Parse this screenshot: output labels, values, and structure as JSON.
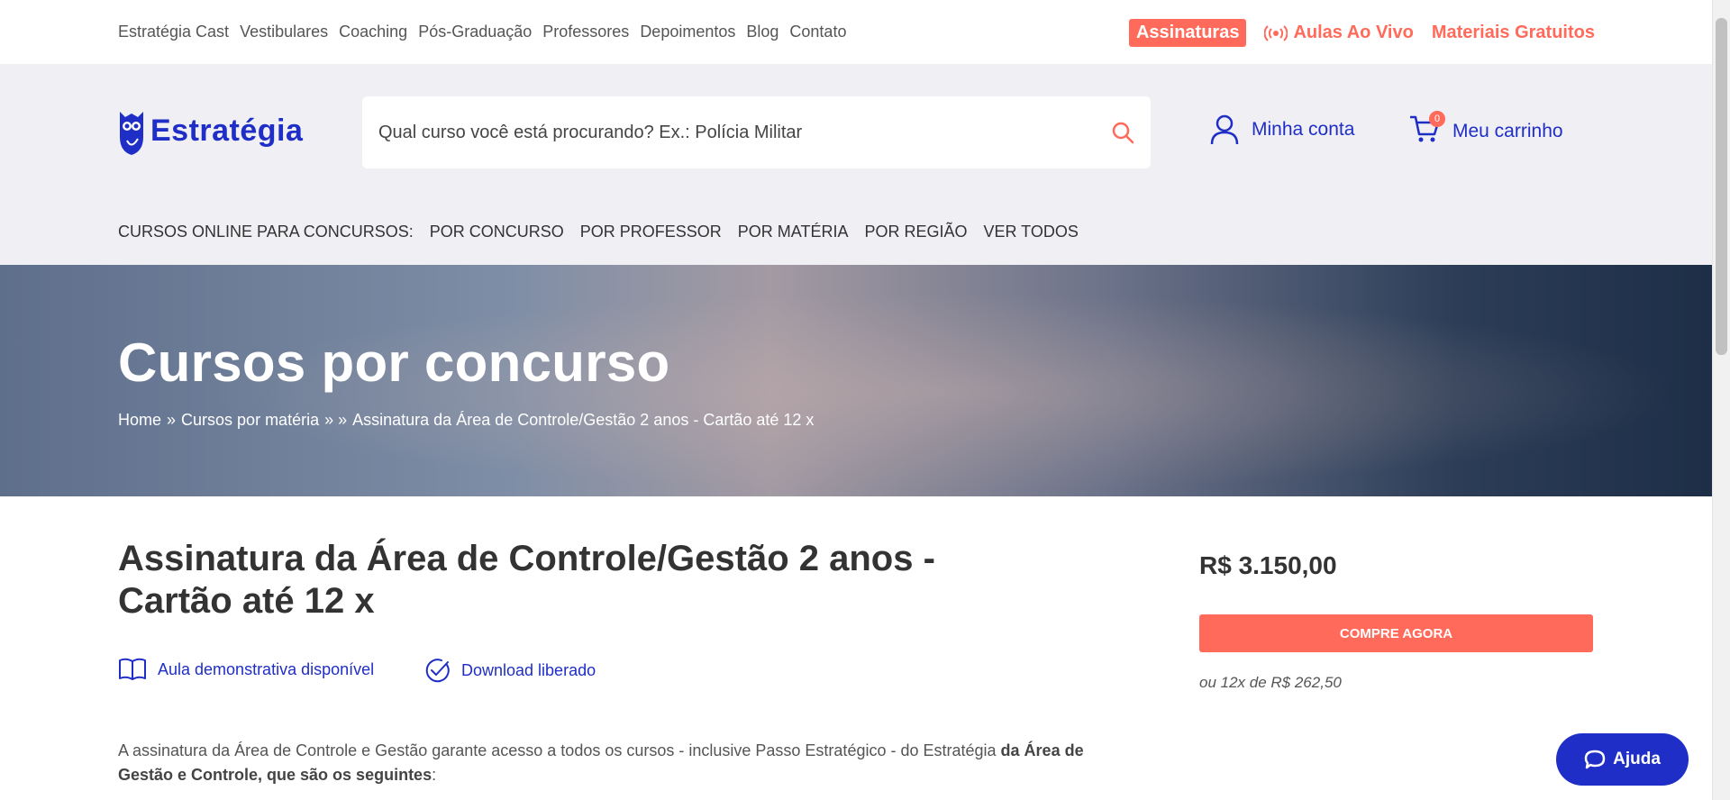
{
  "topbar": {
    "links": [
      "Estratégia Cast",
      "Vestibulares",
      "Coaching",
      "Pós-Graduação",
      "Professores",
      "Depoimentos",
      "Blog",
      "Contato"
    ],
    "assinaturas": "Assinaturas",
    "aulas_ao_vivo": "Aulas Ao Vivo",
    "materiais": "Materiais Gratuitos"
  },
  "header": {
    "logo_text": "Estratégia",
    "search_placeholder": "Qual curso você está procurando? Ex.: Polícia Militar",
    "account_label": "Minha conta",
    "cart_label": "Meu carrinho",
    "cart_count": "0"
  },
  "catnav": {
    "label": "CURSOS ONLINE PARA CONCURSOS:",
    "items": [
      "POR CONCURSO",
      "POR PROFESSOR",
      "POR MATÉRIA",
      "POR REGIÃO",
      "VER TODOS"
    ]
  },
  "hero": {
    "title": "Cursos por concurso",
    "breadcrumb": {
      "home": "Home",
      "sep1": "»",
      "materia": "Cursos por matéria",
      "sep2": "» »",
      "current": "Assinatura da Área de Controle/Gestão 2 anos - Cartão até 12 x"
    }
  },
  "product": {
    "title": "Assinatura da Área de Controle/Gestão 2 anos - Cartão até 12 x",
    "feature_demo": "Aula demonstrativa disponível",
    "feature_download": "Download liberado",
    "price": "R$ 3.150,00",
    "buy_label": "COMPRE AGORA",
    "installments": "ou 12x de R$ 262,50",
    "description_start": " A assinatura da Área de Controle e Gestão garante acesso a todos os cursos - inclusive Passo Estratégico - do Estratégia ",
    "description_bold": "da Área de Gestão e Controle, que são os seguintes",
    "description_end": ":"
  },
  "help": {
    "label": "Ajuda"
  },
  "colors": {
    "brand_blue": "#1f2ec6",
    "accent_coral": "#ff6a5a",
    "header_bg": "#efeff4"
  }
}
